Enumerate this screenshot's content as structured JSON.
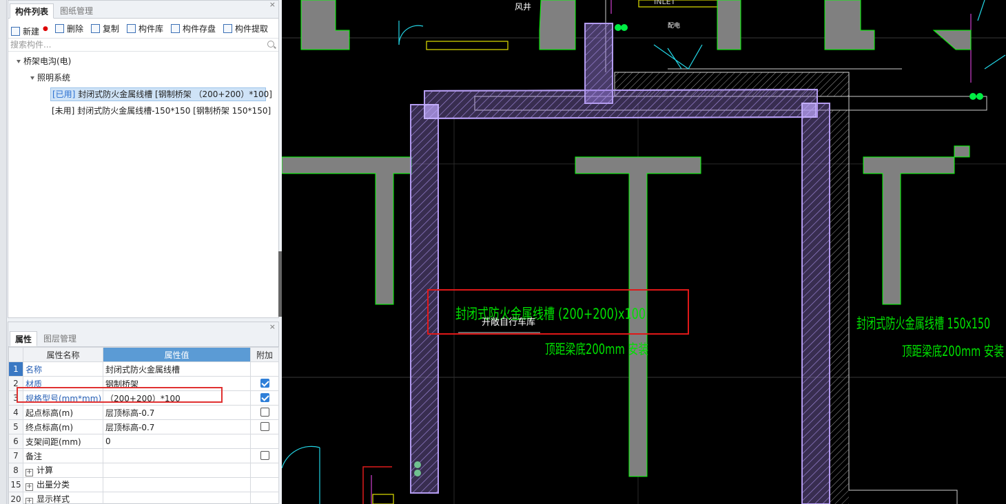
{
  "component_panel": {
    "tabs": [
      "构件列表",
      "图纸管理"
    ],
    "close": "×",
    "toolbar": {
      "new": "新建",
      "delete": "删除",
      "copy": "复制",
      "library": "构件库",
      "save": "构件存盘",
      "extract": "构件提取"
    },
    "search_placeholder": "搜索构件...",
    "tree": {
      "root": "桥架电沟(电)",
      "group": "照明系统",
      "items": [
        {
          "status": "[已用]",
          "text": "封闭式防火金属线槽 [钢制桥架  （200+200）*100]"
        },
        {
          "status": "[未用]",
          "text": "封闭式防火金属线槽-150*150 [钢制桥架 150*150]"
        }
      ]
    }
  },
  "property_panel": {
    "tabs": [
      "属性",
      "图层管理"
    ],
    "close": "×",
    "headers": [
      "属性名称",
      "属性值",
      "附加"
    ],
    "rows": [
      {
        "num": "1",
        "name": "名称",
        "value": "封闭式防火金属线槽",
        "check": null
      },
      {
        "num": "2",
        "name": "材质",
        "value": "钢制桥架",
        "check": true
      },
      {
        "num": "3",
        "name": "规格型号(mm*mm)",
        "value": "（200+200）*100",
        "check": true
      },
      {
        "num": "4",
        "name": "起点标高(m)",
        "value": "层顶标高-0.7",
        "check": false
      },
      {
        "num": "5",
        "name": "终点标高(m)",
        "value": "层顶标高-0.7",
        "check": false
      },
      {
        "num": "6",
        "name": "支架间距(mm)",
        "value": "0",
        "check": null
      },
      {
        "num": "7",
        "name": "备注",
        "value": "",
        "check": false
      },
      {
        "num": "8",
        "name": "计算",
        "value": "",
        "check": null
      },
      {
        "num": "15",
        "name": "出量分类",
        "value": "",
        "check": null
      },
      {
        "num": "20",
        "name": "显示样式",
        "value": "",
        "check": null
      }
    ]
  },
  "cad": {
    "labels": {
      "shaft": "风井",
      "inlet": "INLET",
      "room": "配电",
      "tray_main": "封闭式防火金属线槽 (200+200)x100",
      "overlap": "开敞自行车库",
      "mount_1": "顶距梁底200mm 安装",
      "tray_secondary": "封闭式防火金属线槽 150x150",
      "mount_2": "顶距梁底200mm 安装"
    },
    "colors": {
      "background": "#000000",
      "column": "#808080",
      "outline": "#00ff00",
      "tray": "#b49cf0",
      "annotation": "#00e000",
      "highlight": "#ff0000"
    }
  }
}
